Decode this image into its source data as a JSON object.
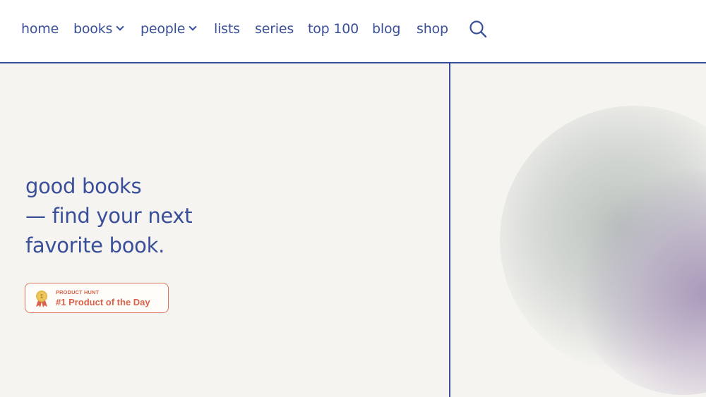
{
  "nav": {
    "items": [
      {
        "label": "home"
      },
      {
        "label": "books"
      },
      {
        "label": "people"
      },
      {
        "label": "lists"
      },
      {
        "label": "series"
      },
      {
        "label": "top 100"
      },
      {
        "label": "blog"
      },
      {
        "label": "shop"
      }
    ],
    "search_icon": "search-icon"
  },
  "hero": {
    "line1": "good books",
    "line2": "— find your next",
    "line3": "favorite book."
  },
  "badge": {
    "small": "PRODUCT HUNT",
    "big": "#1 Product of the Day",
    "medal_number": "1"
  },
  "colors": {
    "accent": "#3a4f99",
    "background": "#f5f4f0",
    "badge": "#d8624a",
    "medal": "#e3b94a"
  }
}
